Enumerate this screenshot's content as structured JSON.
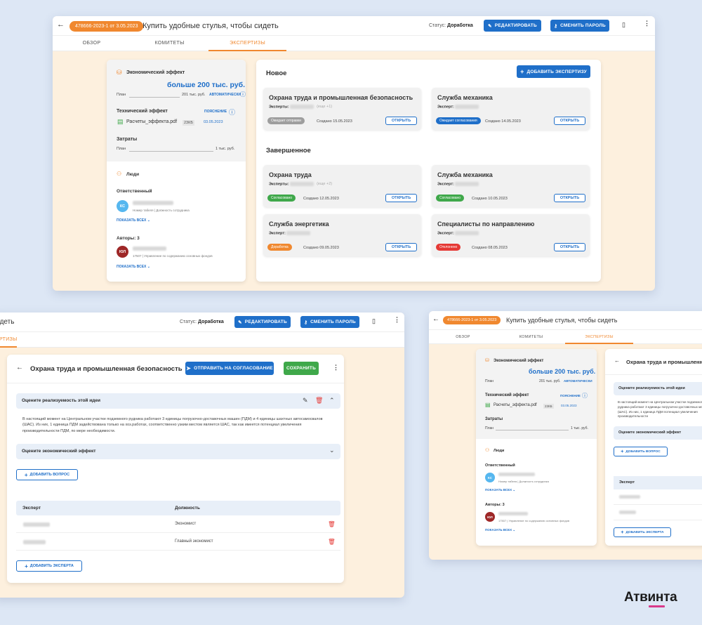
{
  "app": {
    "id_badge": "478666-2023-1 от 3.05.2023",
    "title": "Купить удобные стулья, чтобы сидеть",
    "title_cut": "идеть",
    "status_label": "Статус:",
    "status_value": "Доработка",
    "edit_label": "РЕДАКТИРОВАТЬ",
    "password_label": "СМЕНИТЬ ПАРОЛЬ"
  },
  "tabs": [
    {
      "label": "ОБЗОР"
    },
    {
      "label": "КОМИТЕТЫ"
    },
    {
      "label": "ЭКСПЕРТИЗЫ"
    }
  ],
  "tab_cut": "ЕРТИЗЫ",
  "effect": {
    "title": "Экономический эффект",
    "big_value": "больше 200 тыс. руб.",
    "plan_label": "План",
    "plan_value": "201 тыс. руб.",
    "auto_label": "АВТОМАТИЧЕСКИ",
    "tech_title": "Технический эффект",
    "explain_label": "ПОЯСНЕНИЕ",
    "file_name": "Расчеты_эффекта.pdf",
    "file_size": "23КБ",
    "file_date": "03.05.2023",
    "costs_title": "Затраты",
    "costs_plan_label": "План",
    "costs_value": "1 тыс. руб."
  },
  "people": {
    "title": "Люди",
    "responsible_title": "Ответственный",
    "responsible_initials": "КС",
    "responsible_meta": "Номер табеля | Должность сотрудника",
    "show_all": "ПОКАЗАТЬ ВСЕХ",
    "authors_title": "Авторы: 3",
    "author_initials": "ЮЛ",
    "author_meta": "17507 | Управление по содержанию основных фондов"
  },
  "expertise": {
    "new_title": "Новое",
    "add_label": "ДОБАВИТЬ ЭКСПЕРТИЗУ",
    "done_title": "Завершенное",
    "open_label": "ОТКРЫТЬ",
    "experts_label": "Эксперты:",
    "expert_label": "Эксперт:",
    "new_cards": [
      {
        "title": "Охрана труда и промышленная безопасность",
        "more": "(еще +1)",
        "status": "Ожидает отправки",
        "status_color": "#9e9e9e",
        "created": "Создано 15.05.2023"
      },
      {
        "title": "Служба механика",
        "more": "",
        "status": "Ожидает согласования",
        "status_color": "#1f6fc9",
        "created": "Создано 14.05.2023"
      }
    ],
    "done_cards": [
      {
        "title": "Охрана труда",
        "more": "(еще +2)",
        "status": "Согласовано",
        "status_color": "#3fa84a",
        "created": "Создано 12.05.2023"
      },
      {
        "title": "Служба механика",
        "more": "",
        "status": "Согласовано",
        "status_color": "#3fa84a",
        "created": "Создано 10.05.2023"
      },
      {
        "title": "Служба энергетика",
        "more": "",
        "status": "Доработка",
        "status_color": "#f0882f",
        "created": "Создано 09.05.2023"
      },
      {
        "title": "Специалисты по направлению",
        "more": "",
        "status": "Отклонено",
        "status_color": "#e53935",
        "created": "Создано 08.05.2023"
      }
    ]
  },
  "detail": {
    "title": "Охрана труда и промышленная безопасность",
    "send_label": "ОТПРАВИТЬ НА СОГЛАСОВАНИЕ",
    "save_label": "СОХРАНИТЬ",
    "q1_title": "Оцените реализуемость этой идеи",
    "q1_text": "В настоящий момент на Центральном участке подземного рудника работают 3 единицы погрузочно-доставочных машин (ПДМ) и 4 единицы шахтных автосамосвалов (ШАС). Из них, 1 единица ПДМ задействована только на хоз.работах, соответственно узким местом является ШАС, так как имеется потенциал увеличения производительности ПДМ, по мере необходимости.",
    "q2_title": "Оцените экономический эффект",
    "add_question": "ДОБАВИТЬ ВОПРОС",
    "col_expert": "Эксперт",
    "col_position": "Должность",
    "rows": [
      {
        "position": "Экономист"
      },
      {
        "position": "Главный экономист"
      }
    ],
    "add_expert": "ДОБАВИТЬ ЭКСПЕРТА"
  },
  "third": {
    "q1_text_cut": "В настоящий момент на Центральном участке подземного рудника работают 3 единицы погрузочно-доставочных машин (ШАС). Из них, 1 единица ПДМ потенциал увеличения производительности"
  },
  "brand": {
    "name": "Атвинта"
  },
  "colors": {
    "accent": "#f0882f",
    "primary": "#1f6fc9",
    "success": "#3fa84a",
    "danger": "#e53935",
    "brand_bar": "#d8398a"
  }
}
